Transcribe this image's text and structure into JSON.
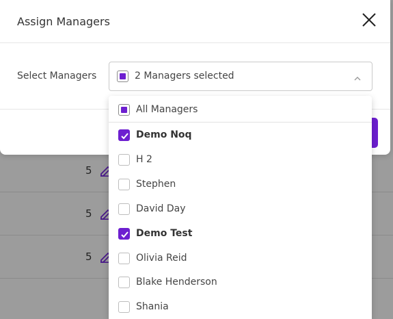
{
  "modal": {
    "title": "Assign Managers",
    "field_label": "Select Managers",
    "select_value": "2 Managers selected"
  },
  "dropdown": {
    "all_label": "All Managers",
    "items": [
      {
        "label": "Demo Noq",
        "checked": true
      },
      {
        "label": "H 2",
        "checked": false
      },
      {
        "label": "Stephen",
        "checked": false
      },
      {
        "label": "David Day",
        "checked": false
      },
      {
        "label": "Demo Test",
        "checked": true
      },
      {
        "label": "Olivia Reid",
        "checked": false
      },
      {
        "label": "Blake Henderson",
        "checked": false
      },
      {
        "label": "Shania",
        "checked": false
      }
    ]
  },
  "background_rows": [
    {
      "value": "5"
    },
    {
      "value": "5"
    },
    {
      "value": "5"
    }
  ],
  "colors": {
    "accent": "#6d1fd0",
    "overlay": "#9c9c9c"
  },
  "icons": {
    "close": "close-icon",
    "chevron": "chevron-up-icon",
    "edit": "pencil-icon"
  }
}
